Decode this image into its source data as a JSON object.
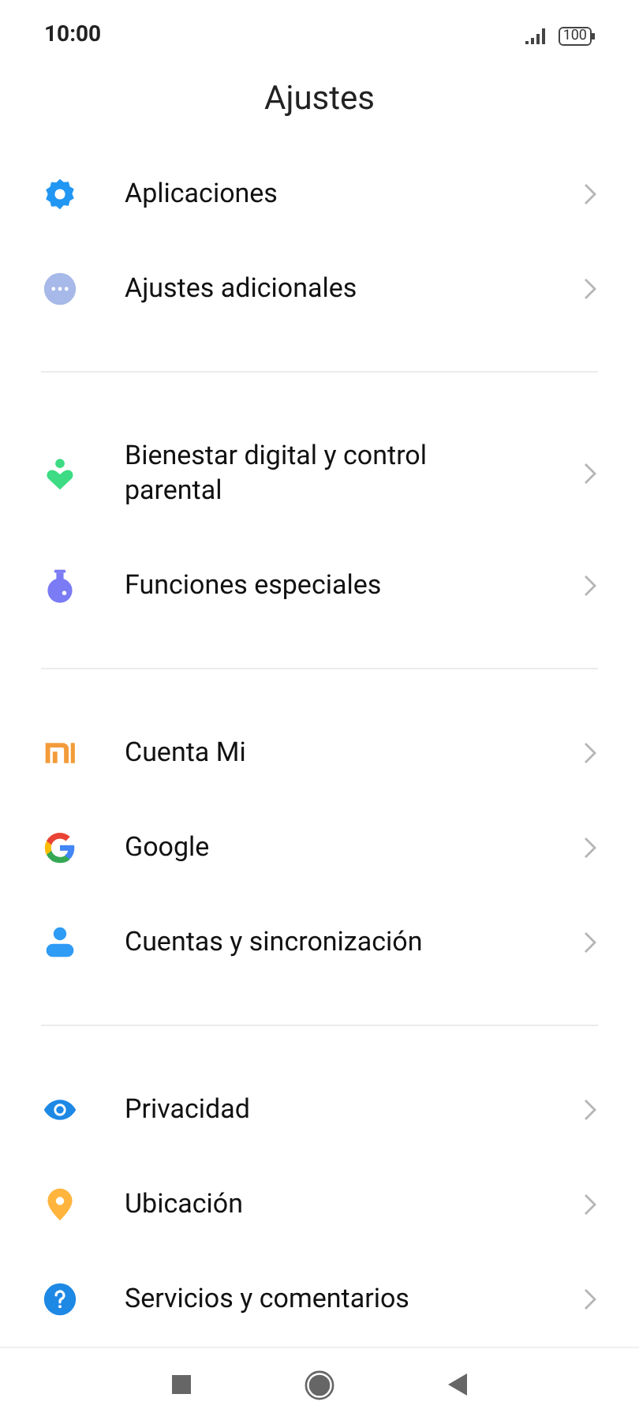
{
  "status_bar": {
    "time": "10:00",
    "battery": "100"
  },
  "title": "Ajustes",
  "sections": [
    {
      "items": [
        {
          "kind": "gear",
          "label": "Aplicaciones"
        },
        {
          "kind": "dots",
          "label": "Ajustes adicionales"
        }
      ]
    },
    {
      "items": [
        {
          "kind": "wellbeing",
          "label": "Bienestar digital y control parental"
        },
        {
          "kind": "flask",
          "label": "Funciones especiales"
        }
      ]
    },
    {
      "items": [
        {
          "kind": "mi",
          "label": "Cuenta Mi"
        },
        {
          "kind": "google",
          "label": "Google"
        },
        {
          "kind": "person",
          "label": "Cuentas y sincronización"
        }
      ]
    },
    {
      "items": [
        {
          "kind": "eye",
          "label": "Privacidad"
        },
        {
          "kind": "pin",
          "label": "Ubicación"
        },
        {
          "kind": "help",
          "label": "Servicios y comentarios"
        }
      ]
    }
  ]
}
